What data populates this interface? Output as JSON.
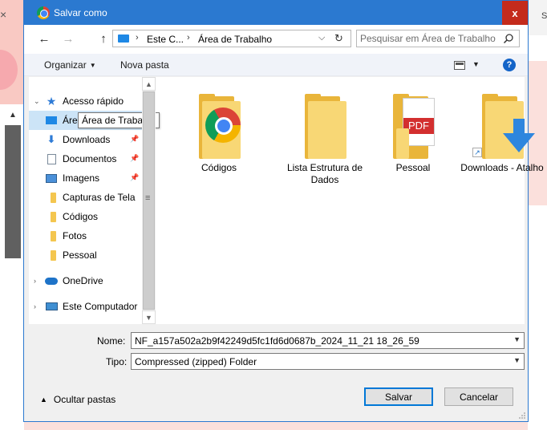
{
  "window": {
    "title": "Salvar como",
    "close_label": "x"
  },
  "nav": {
    "back_icon": "←",
    "forward_icon": "→",
    "up_icon": "↑",
    "breadcrumb": [
      "Este C...",
      "Área de Trabalho"
    ],
    "breadcrumb_sep": "›",
    "refresh_icon": "↻",
    "search_placeholder": "Pesquisar em Área de Trabalho"
  },
  "toolbar": {
    "organize_label": "Organizar",
    "new_folder_label": "Nova pasta",
    "help_label": "?"
  },
  "sidebar": {
    "quick_access": "Acesso rápido",
    "items": [
      {
        "label": "Área de Trabalho",
        "icon": "desktop-icon",
        "pinned": true
      },
      {
        "label": "Downloads",
        "icon": "download-icon",
        "pinned": true
      },
      {
        "label": "Documentos",
        "icon": "documents-icon",
        "pinned": true
      },
      {
        "label": "Imagens",
        "icon": "pictures-icon",
        "pinned": true
      },
      {
        "label": "Capturas de Tela",
        "icon": "folder-icon",
        "pinned": false
      },
      {
        "label": "Códigos",
        "icon": "folder-icon",
        "pinned": false
      },
      {
        "label": "Fotos",
        "icon": "folder-icon",
        "pinned": false
      },
      {
        "label": "Pessoal",
        "icon": "folder-icon",
        "pinned": false
      }
    ],
    "onedrive": "OneDrive",
    "this_pc": "Este Computador",
    "tooltip": "Área de Trabalho"
  },
  "files": [
    {
      "label": "Códigos",
      "icon": "folder-chrome-icon"
    },
    {
      "label": "Lista Estrutura de Dados",
      "icon": "folder-icon"
    },
    {
      "label": "Pessoal",
      "icon": "folder-pdf-icon"
    },
    {
      "label": "Downloads - Atalho",
      "icon": "folder-download-shortcut-icon"
    }
  ],
  "form": {
    "name_label": "Nome:",
    "name_value": "NF_a157a502a2b9f42249d5fc1fd6d0687b_2024_11_21 18_26_59",
    "type_label": "Tipo:",
    "type_value": "Compressed (zipped) Folder"
  },
  "footer": {
    "hide_folders": "Ocultar pastas",
    "save_label": "Salvar",
    "cancel_label": "Cancelar"
  },
  "colors": {
    "titlebar": "#2b79d0",
    "close": "#c42b1c",
    "selection": "#cce4f7",
    "folder": "#f8d775"
  }
}
